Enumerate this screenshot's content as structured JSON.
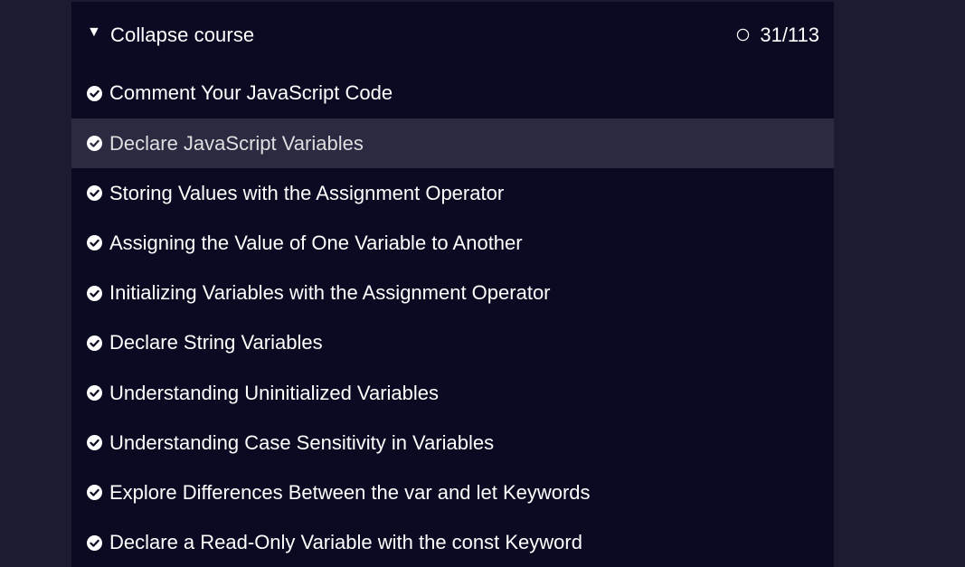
{
  "course": {
    "toggle_label": "Collapse course",
    "toggle_icon": "triangle-down-icon",
    "progress_text": "31/113",
    "progress_fraction": 0.274
  },
  "colors": {
    "page_background": "#1b1b32",
    "panel_background": "#0a0a23",
    "active_row_background": "#2a2a40",
    "text": "#ffffff"
  },
  "lessons": [
    {
      "label": "Comment Your JavaScript Code",
      "completed": true,
      "active": false
    },
    {
      "label": "Declare JavaScript Variables",
      "completed": true,
      "active": true
    },
    {
      "label": "Storing Values with the Assignment Operator",
      "completed": true,
      "active": false
    },
    {
      "label": "Assigning the Value of One Variable to Another",
      "completed": true,
      "active": false
    },
    {
      "label": "Initializing Variables with the Assignment Operator",
      "completed": true,
      "active": false
    },
    {
      "label": "Declare String Variables",
      "completed": true,
      "active": false
    },
    {
      "label": "Understanding Uninitialized Variables",
      "completed": true,
      "active": false
    },
    {
      "label": "Understanding Case Sensitivity in Variables",
      "completed": true,
      "active": false
    },
    {
      "label": "Explore Differences Between the var and let Keywords",
      "completed": true,
      "active": false
    },
    {
      "label": "Declare a Read-Only Variable with the const Keyword",
      "completed": true,
      "active": false
    }
  ]
}
